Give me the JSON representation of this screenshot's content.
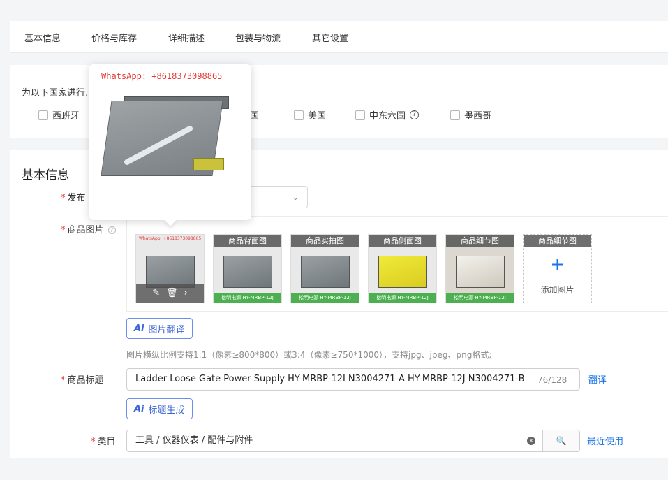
{
  "tabs": [
    "基本信息",
    "价格与库存",
    "详细描述",
    "包装与物流",
    "其它设置"
  ],
  "country_section": {
    "title": "为以下国家进行…差异化设置:",
    "options": [
      "西班牙",
      "韩国",
      "美国",
      "中东六国",
      "墨西哥"
    ],
    "help_icon": "?"
  },
  "basic_info": {
    "section_title": "基本信息",
    "publish_label": "发布",
    "images_label": "商品图片",
    "image_tags": [
      "商品背面图",
      "商品实拍图",
      "商品侧面图",
      "商品细节图",
      "商品细节图"
    ],
    "image_footer": "松明电源 HY-MRBP-12J",
    "first_image_watermark": "WhatsApp: +8618373098865",
    "add_image_label": "添加图片",
    "add_image_icon": "+",
    "image_translate_ai": "Ai",
    "image_translate_button": "图片翻译",
    "image_hint": "图片横纵比例支持1:1（像素≥800*800）或3:4（像素≥750*1000），支持jpg、jpeg、png格式;",
    "edit_icon": "✎",
    "delete_icon": "🗑",
    "next_icon": "›"
  },
  "product_title": {
    "label": "商品标题",
    "value": "Ladder Loose Gate Power Supply HY-MRBP-12I N3004271-A HY-MRBP-12J N3004271-B",
    "count": "76/128",
    "translate_link": "翻译",
    "ai": "Ai",
    "generate_button": "标题生成"
  },
  "category": {
    "label": "类目",
    "value": "工具 / 仪器仪表 / 配件与附件",
    "clear_icon": "×",
    "search_icon": "🔍",
    "recent_link": "最近使用"
  },
  "popover": {
    "whatsapp": "WhatsApp: +8618373098865"
  },
  "required_mark": "*",
  "help_mark": "?",
  "chevron": "⌄"
}
